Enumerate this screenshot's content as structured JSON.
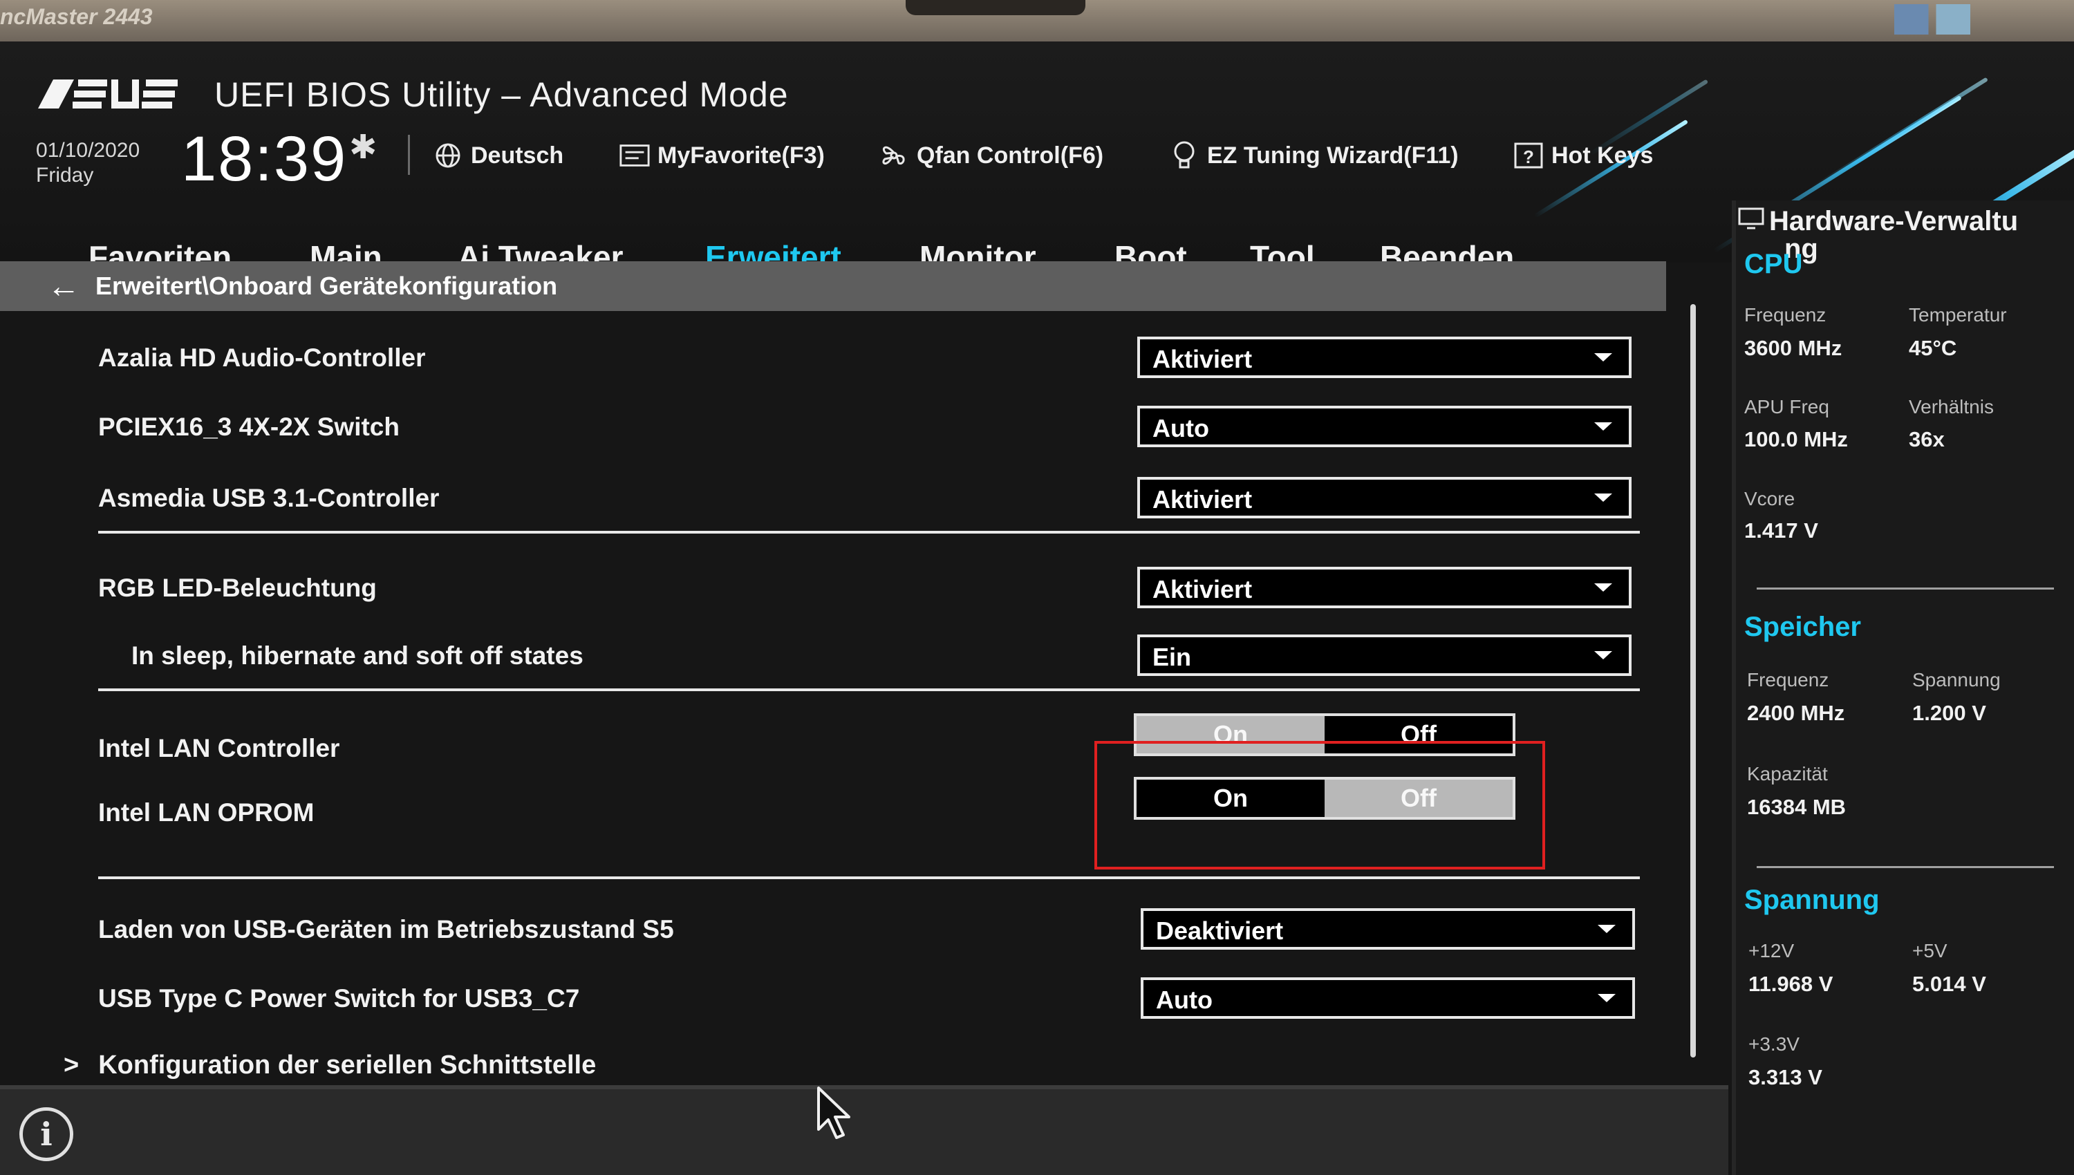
{
  "bezel": {
    "model": "ncMaster 2443"
  },
  "header": {
    "brand": "ASUS",
    "title": "UEFI BIOS Utility – Advanced Mode",
    "date": "01/10/2020",
    "day": "Friday",
    "time": "18:39",
    "toolbar": [
      {
        "label": "Deutsch",
        "icon": "globe-icon"
      },
      {
        "label": "MyFavorite(F3)",
        "icon": "favorites-icon"
      },
      {
        "label": "Qfan Control(F6)",
        "icon": "fan-icon"
      },
      {
        "label": "EZ Tuning Wizard(F11)",
        "icon": "lightbulb-icon"
      },
      {
        "label": "Hot Keys",
        "icon": "question-box-icon"
      }
    ]
  },
  "tabs": [
    "Favoriten",
    "Main",
    "Ai Tweaker",
    "Erweitert",
    "Monitor",
    "Boot",
    "Tool",
    "Beenden"
  ],
  "active_tab": "Erweitert",
  "breadcrumb": "Erweitert\\Onboard Gerätekonfiguration",
  "settings": {
    "azalia": {
      "label": "Azalia HD Audio-Controller",
      "value": "Aktiviert"
    },
    "pciex": {
      "label": "PCIEX16_3 4X-2X Switch",
      "value": "Auto"
    },
    "asmedia": {
      "label": "Asmedia USB 3.1-Controller",
      "value": "Aktiviert"
    },
    "rgb": {
      "label": "RGB LED-Beleuchtung",
      "value": "Aktiviert"
    },
    "sleep": {
      "label": "In sleep, hibernate and soft off states",
      "value": "Ein"
    },
    "lan": {
      "label": "Intel LAN Controller",
      "on": "On",
      "off": "Off",
      "selected": "On"
    },
    "oprom": {
      "label": "Intel LAN OPROM",
      "on": "On",
      "off": "Off",
      "selected": "Off"
    },
    "usb_s5": {
      "label": "Laden von USB-Geräten im Betriebszustand S5",
      "value": "Deaktiviert"
    },
    "usbc": {
      "label": "USB Type C Power Switch for USB3_C7",
      "value": "Auto"
    },
    "serial": {
      "label": "Konfiguration der seriellen Schnittstelle"
    }
  },
  "hw": {
    "title_a": "Hardware-Verwaltu",
    "title_b": "ng",
    "cpu": {
      "heading": "CPU",
      "freq_k": "Frequenz",
      "freq_v": "3600 MHz",
      "temp_k": "Temperatur",
      "temp_v": "45°C",
      "apu_k": "APU Freq",
      "apu_v": "100.0 MHz",
      "ratio_k": "Verhältnis",
      "ratio_v": "36x",
      "vcore_k": "Vcore",
      "vcore_v": "1.417 V"
    },
    "mem": {
      "heading": "Speicher",
      "freq_k": "Frequenz",
      "freq_v": "2400 MHz",
      "volt_k": "Spannung",
      "volt_v": "1.200 V",
      "cap_k": "Kapazität",
      "cap_v": "16384 MB"
    },
    "volt": {
      "heading": "Spannung",
      "v12_k": "+12V",
      "v12_v": "11.968 V",
      "v5_k": "+5V",
      "v5_v": "5.014 V",
      "v33_k": "+3.3V",
      "v33_v": "3.313 V"
    }
  },
  "colors": {
    "accent": "#1fc8f0",
    "highlight": "#e02020",
    "background": "#161616"
  }
}
